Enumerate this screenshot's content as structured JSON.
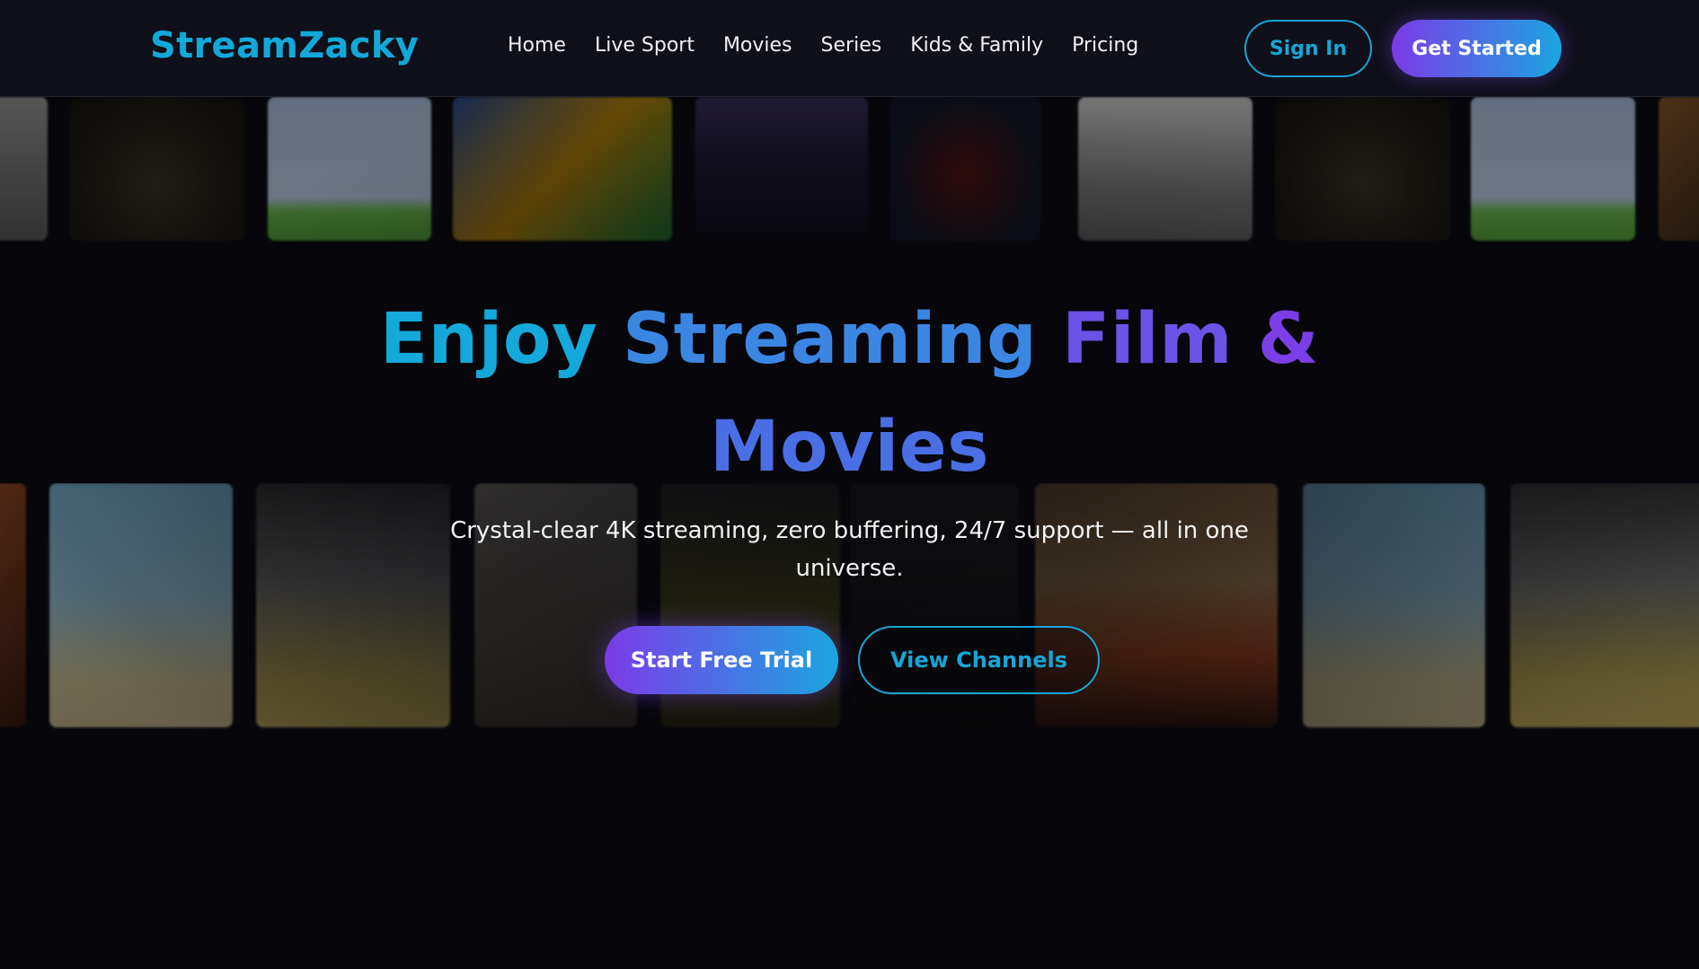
{
  "brand": {
    "name": "StreamZacky"
  },
  "nav": {
    "items": [
      {
        "label": "Home"
      },
      {
        "label": "Live Sport"
      },
      {
        "label": "Movies"
      },
      {
        "label": "Series"
      },
      {
        "label": "Kids & Family"
      },
      {
        "label": "Pricing"
      }
    ],
    "sign_in": "Sign In",
    "get_started": "Get Started"
  },
  "hero": {
    "title_words": [
      "Enjoy",
      "Streaming",
      "Film",
      "&",
      "Movies"
    ],
    "subtitle": "Crystal-clear 4K streaming, zero buffering, 24/7 support — all in one universe.",
    "primary_cta": "Start Free Trial",
    "secondary_cta": "View Channels"
  },
  "colors": {
    "accent_cyan": "#14a9da",
    "accent_purple": "#7b3be8",
    "background": "#06060b"
  }
}
